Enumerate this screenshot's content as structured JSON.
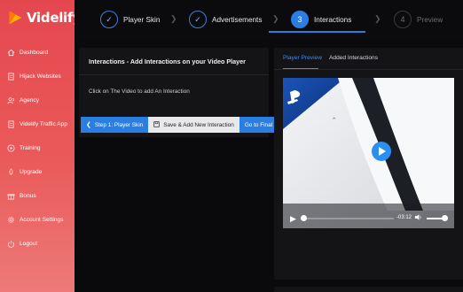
{
  "brand": {
    "name": "Videlify"
  },
  "sidebar": {
    "items": [
      {
        "label": "Dashboard",
        "icon": "home-icon"
      },
      {
        "label": "Hijack Websites",
        "icon": "document-icon"
      },
      {
        "label": "Agency",
        "icon": "users-icon"
      },
      {
        "label": "Videlify Traffic App",
        "icon": "document-icon"
      },
      {
        "label": "Training",
        "icon": "play-circle-icon"
      },
      {
        "label": "Upgrade",
        "icon": "rocket-icon"
      },
      {
        "label": "Bonus",
        "icon": "gift-icon"
      },
      {
        "label": "Account Settings",
        "icon": "gear-icon"
      },
      {
        "label": "Logout",
        "icon": "power-icon"
      }
    ]
  },
  "stepper": {
    "steps": [
      {
        "label": "Player Skin",
        "state": "done",
        "number": ""
      },
      {
        "label": "Advertisements",
        "state": "done",
        "number": ""
      },
      {
        "label": "Interactions",
        "state": "active",
        "number": "3"
      },
      {
        "label": "Preview",
        "state": "pending",
        "number": "4"
      }
    ]
  },
  "interactions_panel": {
    "title": "Interactions - Add Interactions on your Video Player",
    "hint": "Click on The Video to add An Interaction",
    "back_button": "Step 1: Player Skin",
    "save_button": "Save & Add New Interaction",
    "final_button": "Go to Final Video"
  },
  "preview_panel": {
    "tabs": [
      "Player Preview",
      "Added Interactions"
    ],
    "active_tab": "Player Preview",
    "player": {
      "time": "-03:12",
      "progress": 0.02,
      "volume": 0.85
    }
  },
  "colors": {
    "accent": "#2a7de1",
    "sidebar_top": "#e5474f",
    "sidebar_bottom": "#ec7a78",
    "background": "#0a0a0c",
    "panel": "#141417"
  }
}
